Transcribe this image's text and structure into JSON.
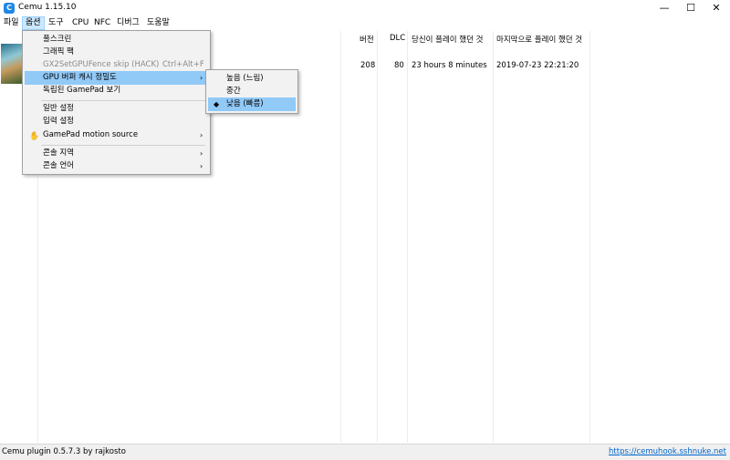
{
  "window": {
    "title": "Cemu 1.15.10",
    "icon_label": "C"
  },
  "window_controls": {
    "minimize": "—",
    "maximize": "☐",
    "close": "✕"
  },
  "menubar": [
    "파일",
    "옵션",
    "도구",
    "CPU",
    "NFC",
    "디버그",
    "도움말"
  ],
  "table": {
    "headers": {
      "version": "버전",
      "dlc": "DLC",
      "played": "당신이 플레이 했던 것",
      "last": "마지막으로 플레이 했던 것"
    },
    "rows": [
      {
        "version": "208",
        "dlc": "80",
        "played": "23 hours 8 minutes",
        "last": "2019-07-23 22:21:20"
      }
    ]
  },
  "options_menu": {
    "items": [
      {
        "label": "풀스크린"
      },
      {
        "label": "그래픽 팩"
      },
      {
        "label": "GX2SetGPUFence skip (HACK)",
        "shortcut": "Ctrl+Alt+F"
      },
      {
        "label": "GPU 버퍼 캐시 정밀도",
        "arrow": "›"
      },
      {
        "label": "독립된 GamePad 보기"
      },
      {
        "label": "일반 설정"
      },
      {
        "label": "입력 설정"
      },
      {
        "label": "GamePad motion source",
        "arrow": "›",
        "icon": "gamepad-icon"
      },
      {
        "label": "콘솔 지역",
        "arrow": "›"
      },
      {
        "label": "콘솔 언어",
        "arrow": "›"
      }
    ]
  },
  "gpu_submenu": {
    "items": [
      {
        "label": "높음 (느림)"
      },
      {
        "label": "중간"
      },
      {
        "label": "낮음 (빠름)",
        "check": "◆"
      }
    ]
  },
  "statusbar": {
    "left": "Cemu plugin 0.5.7.3 by rajkosto",
    "right": "https://cemuhook.sshnuke.net"
  }
}
